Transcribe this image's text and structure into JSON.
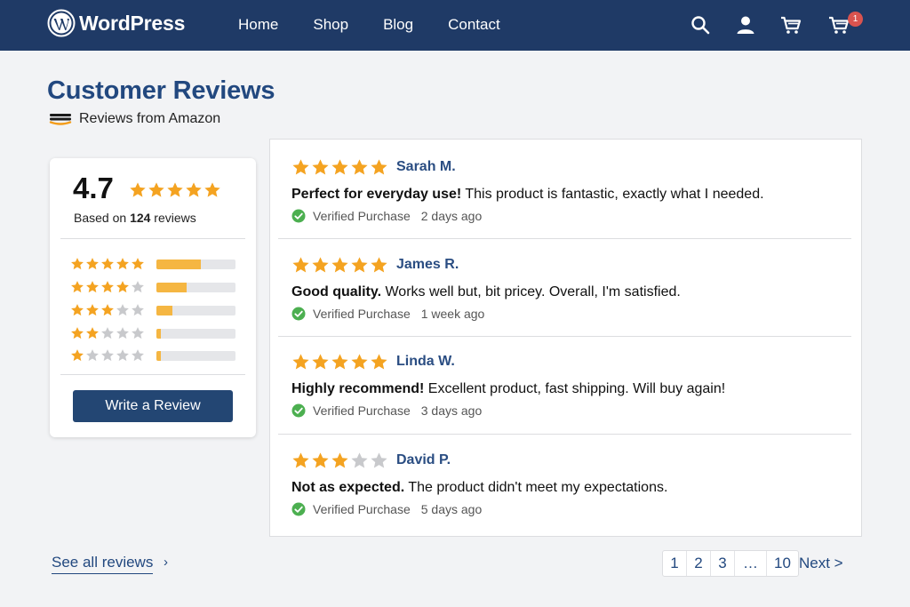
{
  "header": {
    "brand": "WordPress",
    "nav": [
      "Home",
      "Shop",
      "Blog",
      "Contact"
    ],
    "icons": [
      "search-icon",
      "user-icon",
      "cart-icon",
      "cart-with-badge-icon"
    ],
    "cart_count": "1",
    "bg_color": "#1f3a66"
  },
  "page": {
    "title": "Customer Reviews",
    "subtitle": "Reviews from Amazon"
  },
  "summary": {
    "average": "4.7",
    "average_stars": 5,
    "based_prefix": "Based on ",
    "review_count": "124",
    "based_suffix": " reviews",
    "distribution": [
      {
        "stars": 5,
        "fraction": 0.56
      },
      {
        "stars": 4,
        "fraction": 0.38
      },
      {
        "stars": 3,
        "fraction": 0.2
      },
      {
        "stars": 2,
        "fraction": 0.06
      },
      {
        "stars": 1,
        "fraction": 0.06
      }
    ],
    "write_button": "Write a Review"
  },
  "reviews": [
    {
      "name": "Sarah M.",
      "rating": 5,
      "headline": "Perfect for everyday use!",
      "body": "  This product is fantastic, exactly what I needed.",
      "verified": "Verified Purchase",
      "when": "2 days ago"
    },
    {
      "name": "James R.",
      "rating": 5,
      "headline": "Good quality.",
      "body": " Works well but, bit pricey. Overall, I'm satisfied.",
      "verified": "Verified Purchase",
      "when": "1 week ago"
    },
    {
      "name": "Linda W.",
      "rating": 5,
      "headline": "Highly recommend!",
      "body": " Excellent product, fast shipping. Will buy again!",
      "verified": "Verified Purchase",
      "when": "3 days ago"
    },
    {
      "name": "David P.",
      "rating": 3,
      "headline": "Not as expected.",
      "body": " The product didn't meet my expectations.",
      "verified": "Verified Purchase",
      "when": "5 days ago"
    }
  ],
  "footer": {
    "see_all": "See all reviews",
    "see_all_chevron": "›",
    "pages": [
      "1",
      "2",
      "3",
      "…",
      "10"
    ],
    "next": "Next >"
  },
  "colors": {
    "star": "#f4a321",
    "star_empty": "#c8c9cc",
    "accent": "#22487f",
    "verified": "#4caf50"
  }
}
